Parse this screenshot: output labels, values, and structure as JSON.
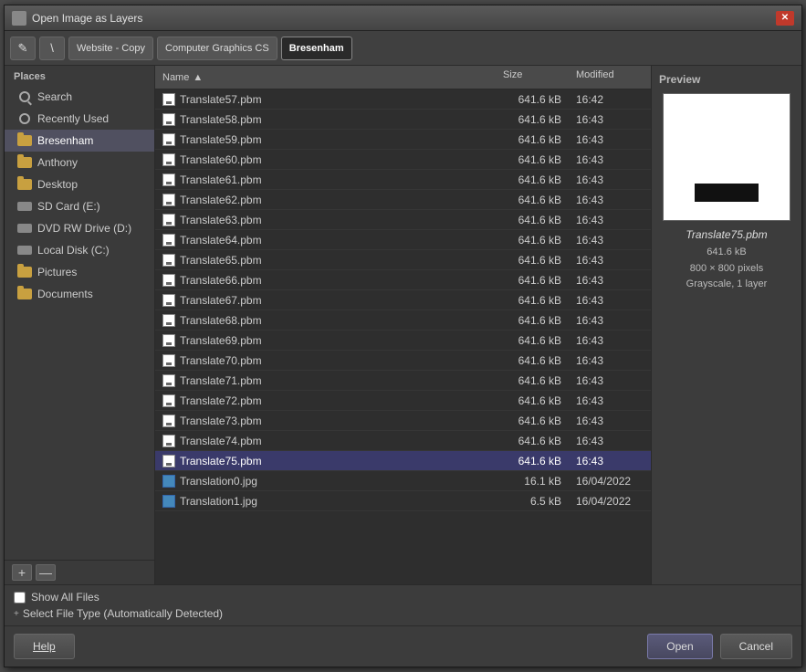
{
  "titleBar": {
    "title": "Open Image as Layers",
    "closeBtn": "✕"
  },
  "toolbar": {
    "editIcon": "✎",
    "slashIcon": "\\",
    "tabs": [
      {
        "label": "Website - Copy",
        "active": false
      },
      {
        "label": "Computer Graphics CS",
        "active": false
      },
      {
        "label": "Bresenham",
        "active": true
      }
    ]
  },
  "sidebar": {
    "header": "Places",
    "items": [
      {
        "label": "Search",
        "type": "search"
      },
      {
        "label": "Recently Used",
        "type": "recent"
      },
      {
        "label": "Bresenham",
        "type": "folder",
        "active": true
      },
      {
        "label": "Anthony",
        "type": "folder"
      },
      {
        "label": "Desktop",
        "type": "folder"
      },
      {
        "label": "SD Card (E:)",
        "type": "drive"
      },
      {
        "label": "DVD RW Drive (D:)",
        "type": "drive"
      },
      {
        "label": "Local Disk (C:)",
        "type": "drive"
      },
      {
        "label": "Pictures",
        "type": "folder"
      },
      {
        "label": "Documents",
        "type": "folder"
      }
    ],
    "addBtn": "+",
    "removeBtn": "—"
  },
  "fileList": {
    "columns": [
      "Name",
      "Size",
      "Modified"
    ],
    "files": [
      {
        "name": "Translate57.pbm",
        "size": "641.6 kB",
        "modified": "16:42",
        "type": "pbm"
      },
      {
        "name": "Translate58.pbm",
        "size": "641.6 kB",
        "modified": "16:43",
        "type": "pbm"
      },
      {
        "name": "Translate59.pbm",
        "size": "641.6 kB",
        "modified": "16:43",
        "type": "pbm"
      },
      {
        "name": "Translate60.pbm",
        "size": "641.6 kB",
        "modified": "16:43",
        "type": "pbm"
      },
      {
        "name": "Translate61.pbm",
        "size": "641.6 kB",
        "modified": "16:43",
        "type": "pbm"
      },
      {
        "name": "Translate62.pbm",
        "size": "641.6 kB",
        "modified": "16:43",
        "type": "pbm"
      },
      {
        "name": "Translate63.pbm",
        "size": "641.6 kB",
        "modified": "16:43",
        "type": "pbm"
      },
      {
        "name": "Translate64.pbm",
        "size": "641.6 kB",
        "modified": "16:43",
        "type": "pbm"
      },
      {
        "name": "Translate65.pbm",
        "size": "641.6 kB",
        "modified": "16:43",
        "type": "pbm"
      },
      {
        "name": "Translate66.pbm",
        "size": "641.6 kB",
        "modified": "16:43",
        "type": "pbm"
      },
      {
        "name": "Translate67.pbm",
        "size": "641.6 kB",
        "modified": "16:43",
        "type": "pbm"
      },
      {
        "name": "Translate68.pbm",
        "size": "641.6 kB",
        "modified": "16:43",
        "type": "pbm"
      },
      {
        "name": "Translate69.pbm",
        "size": "641.6 kB",
        "modified": "16:43",
        "type": "pbm"
      },
      {
        "name": "Translate70.pbm",
        "size": "641.6 kB",
        "modified": "16:43",
        "type": "pbm"
      },
      {
        "name": "Translate71.pbm",
        "size": "641.6 kB",
        "modified": "16:43",
        "type": "pbm"
      },
      {
        "name": "Translate72.pbm",
        "size": "641.6 kB",
        "modified": "16:43",
        "type": "pbm"
      },
      {
        "name": "Translate73.pbm",
        "size": "641.6 kB",
        "modified": "16:43",
        "type": "pbm"
      },
      {
        "name": "Translate74.pbm",
        "size": "641.6 kB",
        "modified": "16:43",
        "type": "pbm"
      },
      {
        "name": "Translate75.pbm",
        "size": "641.6 kB",
        "modified": "16:43",
        "type": "pbm",
        "selected": true
      },
      {
        "name": "Translation0.jpg",
        "size": "16.1 kB",
        "modified": "16/04/2022",
        "type": "jpg"
      },
      {
        "name": "Translation1.jpg",
        "size": "6.5 kB",
        "modified": "16/04/2022",
        "type": "jpg"
      }
    ]
  },
  "preview": {
    "header": "Preview",
    "filename": "Translate75.pbm",
    "size": "641.6 kB",
    "dimensions": "800 × 800 pixels",
    "colorMode": "Grayscale, 1 layer"
  },
  "bottomOptions": {
    "showAllFiles": "Show All Files",
    "selectFileType": "Select File Type (Automatically Detected)"
  },
  "buttons": {
    "help": "Help",
    "open": "Open",
    "cancel": "Cancel"
  }
}
